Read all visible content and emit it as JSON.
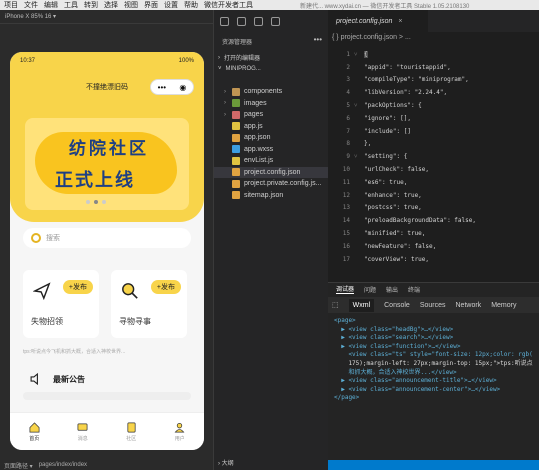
{
  "menubar": {
    "items": [
      "项目",
      "文件",
      "编辑",
      "工具",
      "转到",
      "选择",
      "视图",
      "界面",
      "设置",
      "帮助",
      "微信开发者工具"
    ],
    "window_title": "新建代... www.xydai.cn — 微信开发者工具 Stable 1.05.2108130"
  },
  "simulator": {
    "device": "iPhone X 85% 16 ▾",
    "status_time": "10:37",
    "status_battery": "100%",
    "nav_title": "不撞绝漂旧码",
    "capsule_more": "•••",
    "banner_line1": "纺院社区",
    "banner_line2": "正式上线",
    "search_placeholder": "搜索",
    "cards": [
      {
        "label": "失物招领",
        "pill": "+发布"
      },
      {
        "label": "寻物寻事",
        "pill": "+发布"
      }
    ],
    "tip_text": "tps:听说点今飞机和抓大概，合适入神校世界...",
    "announcement_title": "最新公告",
    "tabs": [
      "首页",
      "消息",
      "社区",
      "用户"
    ],
    "page_path_label": "页面路径 ▾",
    "page_path": "pages/index/index"
  },
  "explorer": {
    "title": "资源管理器",
    "more": "•••",
    "open_editors": "打开的编辑器",
    "project": "MINIPROG...",
    "items": [
      {
        "name": "components",
        "type": "folder",
        "color": "#c09553"
      },
      {
        "name": "images",
        "type": "folder",
        "color": "#6b9a3a"
      },
      {
        "name": "pages",
        "type": "folder",
        "color": "#d16969"
      },
      {
        "name": "app.js",
        "type": "file",
        "color": "#e0c341"
      },
      {
        "name": "app.json",
        "type": "file",
        "color": "#e0a341"
      },
      {
        "name": "app.wxss",
        "type": "file",
        "color": "#3d9ee0"
      },
      {
        "name": "envList.js",
        "type": "file",
        "color": "#e0c341"
      },
      {
        "name": "project.config.json",
        "type": "file",
        "color": "#e0a341"
      },
      {
        "name": "project.private.config.js...",
        "type": "file",
        "color": "#e0a341"
      },
      {
        "name": "sitemap.json",
        "type": "file",
        "color": "#e0a341"
      }
    ],
    "outline": "大纲"
  },
  "editor": {
    "tab": "project.config.json",
    "breadcrumb": "{ } project.config.json > ...",
    "lines": [
      {
        "n": "1",
        "fold": "˅",
        "text": "{"
      },
      {
        "n": "2",
        "fold": "",
        "text": "\"appid\": \"touristappid\","
      },
      {
        "n": "3",
        "fold": "",
        "text": "\"compileType\": \"miniprogram\","
      },
      {
        "n": "4",
        "fold": "",
        "text": "\"libVersion\": \"2.24.4\","
      },
      {
        "n": "5",
        "fold": "˅",
        "text": "\"packOptions\": {"
      },
      {
        "n": "6",
        "fold": "",
        "text": "  \"ignore\": [],"
      },
      {
        "n": "7",
        "fold": "",
        "text": "  \"include\": []"
      },
      {
        "n": "8",
        "fold": "",
        "text": "},"
      },
      {
        "n": "9",
        "fold": "˅",
        "text": "\"setting\": {"
      },
      {
        "n": "10",
        "fold": "",
        "text": "  \"urlCheck\": false,"
      },
      {
        "n": "11",
        "fold": "",
        "text": "  \"es6\": true,"
      },
      {
        "n": "12",
        "fold": "",
        "text": "  \"enhance\": true,"
      },
      {
        "n": "13",
        "fold": "",
        "text": "  \"postcss\": true,"
      },
      {
        "n": "14",
        "fold": "",
        "text": "  \"preloadBackgroundData\": false,"
      },
      {
        "n": "15",
        "fold": "",
        "text": "  \"minified\": true,"
      },
      {
        "n": "16",
        "fold": "",
        "text": "  \"newFeature\": false,"
      },
      {
        "n": "17",
        "fold": "",
        "text": "  \"coverView\": true,"
      }
    ]
  },
  "devtools": {
    "top_tabs": [
      "调试器",
      "问题",
      "输出",
      "终端"
    ],
    "tabs": [
      "Wxml",
      "Console",
      "Sources",
      "Network",
      "Memory"
    ],
    "dom": [
      "<page>",
      "  ▶ <view class=\"headBg\">…</view>",
      "  ▶ <view class=\"search\">…</view>",
      "  ▶ <view class=\"function\">…</view>",
      "    <view class=\"ts\" style=\"font-size: 12px;color: rgb(",
      "    175);margin-left: 27px;margin-top: 15px;\">tps:听说点",
      "    和抓大概，合适入神校世界...</view>",
      "  ▶ <view class=\"announcement-title\">…</view>",
      "  ▶ <view class=\"announcement-center\">…</view>",
      "</page>"
    ]
  }
}
